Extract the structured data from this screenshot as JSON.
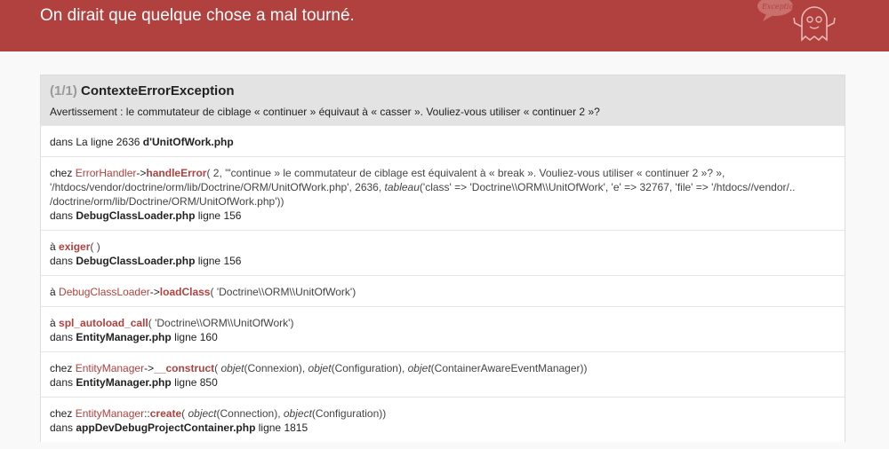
{
  "header": {
    "title": "On dirait que quelque chose a mal tourné.",
    "logo_text": "Exception!"
  },
  "exception": {
    "count": "(1/1)",
    "name": "ContexteErrorException",
    "message": "Avertissement : le commutateur de ciblage « continuer » équivaut à « casser ». Vouliez-vous utiliser « continuer 2 »?"
  },
  "location": {
    "prefix": "dans La ligne 2636",
    "file": "d'UnitOfWork.php"
  },
  "trace": [
    {
      "prefix": "chez",
      "class": "ErrorHandler",
      "op": "->",
      "method": "handleError",
      "args": [
        {
          "t": "( 2, '\"continue » le commutateur de ciblage est équivalent à « break ». Vouliez-vous utiliser « continuer 2 »? », '/htdocs/vendor/doctrine/orm/lib/Doctrine/ORM/UnitOfWork.php', 2636, "
        },
        {
          "t": "tableau",
          "i": true
        },
        {
          "t": "('class' => 'Doctrine\\\\ORM\\\\UnitOfWork', 'e' => 32767, 'file' => '/htdocs//vendor/.. /doctrine/orm/lib/Doctrine/ORM/UnitOfWork.php'))"
        }
      ],
      "in": "dans",
      "file": "DebugClassLoader.php",
      "line": "ligne 156"
    },
    {
      "prefix": "à",
      "class": "",
      "op": "",
      "method": "exiger",
      "args": [
        {
          "t": "( )"
        }
      ],
      "in": "dans",
      "file": "DebugClassLoader.php",
      "line": "ligne 156"
    },
    {
      "prefix": "à",
      "class": "DebugClassLoader",
      "op": "->",
      "method": "loadClass",
      "args": [
        {
          "t": "( 'Doctrine\\\\ORM\\\\UnitOfWork')"
        }
      ]
    },
    {
      "prefix": "à",
      "class": "",
      "op": "",
      "method": "spl_autoload_call",
      "args": [
        {
          "t": "( 'Doctrine\\\\ORM\\\\UnitOfWork')"
        }
      ],
      "in": "dans",
      "file": "EntityManager.php",
      "line": "ligne 160"
    },
    {
      "prefix": "chez",
      "class": "EntityManager",
      "op": "->",
      "method": "__construct",
      "args": [
        {
          "t": "( "
        },
        {
          "t": "objet",
          "i": true
        },
        {
          "t": "(Connexion), "
        },
        {
          "t": "objet",
          "i": true
        },
        {
          "t": "(Configuration), "
        },
        {
          "t": "objet",
          "i": true
        },
        {
          "t": "(ContainerAwareEventManager))"
        }
      ],
      "in": "dans",
      "file": "EntityManager.php",
      "line": "ligne 850"
    },
    {
      "prefix": "chez",
      "class": "EntityManager",
      "op": "::",
      "method": "create",
      "args": [
        {
          "t": "( "
        },
        {
          "t": "object",
          "i": true
        },
        {
          "t": "(Connection), "
        },
        {
          "t": "object",
          "i": true
        },
        {
          "t": "(Configuration))"
        }
      ],
      "in": "dans",
      "file": "appDevDebugProjectContainer.php",
      "line": "ligne 1815"
    }
  ]
}
